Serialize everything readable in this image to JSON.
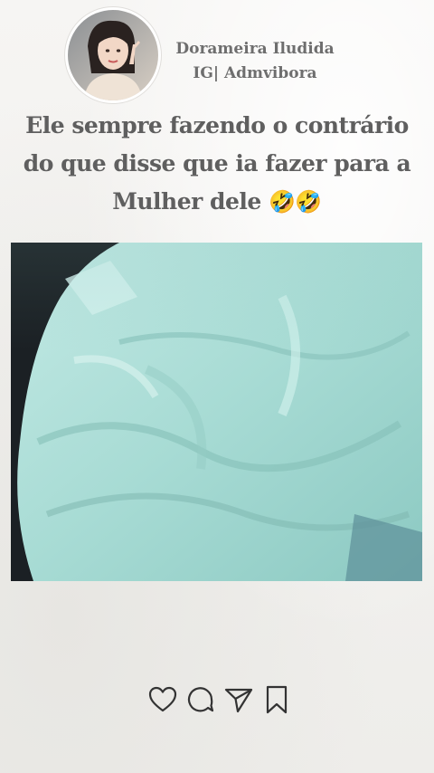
{
  "profile": {
    "name": "Dorameira Iludida",
    "handle": "IG| Admvibora"
  },
  "post": {
    "caption": "Ele sempre fazendo o contrário do que disse que ia fazer para a Mulher dele",
    "emojis": "🤣🤣",
    "media_description_icon": "bedsheet-video-frame"
  },
  "actions": [
    {
      "icon": "heart-icon"
    },
    {
      "icon": "comment-icon"
    },
    {
      "icon": "share-icon"
    },
    {
      "icon": "bookmark-icon"
    }
  ],
  "colors": {
    "background": "#f3f2ef",
    "text": "#5f5f5f",
    "profile_text": "#6e6e6e",
    "icon_stroke": "#333333",
    "sheet": "#a9dcd6"
  }
}
